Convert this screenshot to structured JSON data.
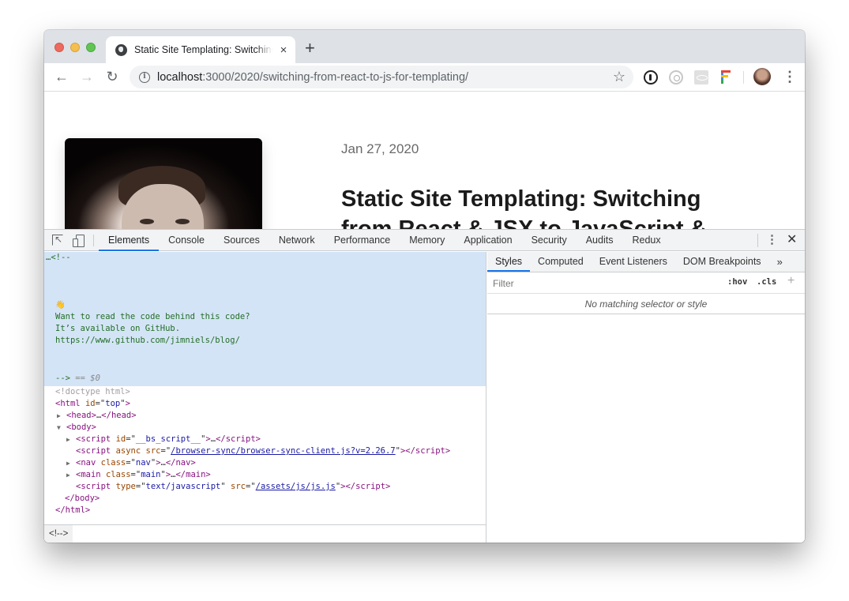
{
  "browser": {
    "tab": {
      "title": "Static Site Templating: Switching from React & JSX to JavaScript & Template Literals",
      "favicon": "globe-icon",
      "close_label": "×"
    },
    "new_tab_label": "+",
    "nav": {
      "back": "←",
      "forward": "→",
      "reload": "↻"
    },
    "address": {
      "host": "localhost",
      "path": ":3000/2020/switching-from-react-to-js-for-templating/"
    },
    "bookmark_icon": "☆",
    "extensions": [
      "1password-icon",
      "extension-icon",
      "react-devtools-icon",
      "figma-f-icon"
    ],
    "menu_icon": "⋮"
  },
  "page": {
    "date": "Jan 27, 2020",
    "title": "Static Site Templating: Switching from React & JSX to JavaScript &"
  },
  "devtools": {
    "tabs": [
      "Elements",
      "Console",
      "Sources",
      "Network",
      "Performance",
      "Memory",
      "Application",
      "Security",
      "Audits",
      "Redux"
    ],
    "active_tab": "Elements",
    "menu_icon": "⋮",
    "close_icon": "✕",
    "dom": {
      "comment_open": "…<!--",
      "emoji": "👋",
      "comment_lines": [
        "Want to read the code behind this code?",
        "It’s available on GitHub.",
        "https://www.github.com/jimniels/blog/"
      ],
      "comment_close": "-->",
      "selected_marker": "== $0",
      "doctype": "<!doctype html>",
      "html_tag": "html",
      "html_id_attr": "id",
      "html_id_val": "top",
      "head": "head",
      "body": "body",
      "script1_id": "__bs_script__",
      "script2_src": "/browser-sync/browser-sync-client.js?v=2.26.7",
      "nav_class": "nav",
      "main_class": "main",
      "script3_type": "text/javascript",
      "script3_src": "/assets/js/js.js"
    },
    "breadcrumb": "<!-->",
    "sidebar": {
      "tabs": [
        "Styles",
        "Computed",
        "Event Listeners",
        "DOM Breakpoints"
      ],
      "more": "»",
      "active_tab": "Styles",
      "filter_placeholder": "Filter",
      "hov": ":hov",
      "cls": ".cls",
      "add": "+",
      "empty_message": "No matching selector or style"
    }
  }
}
